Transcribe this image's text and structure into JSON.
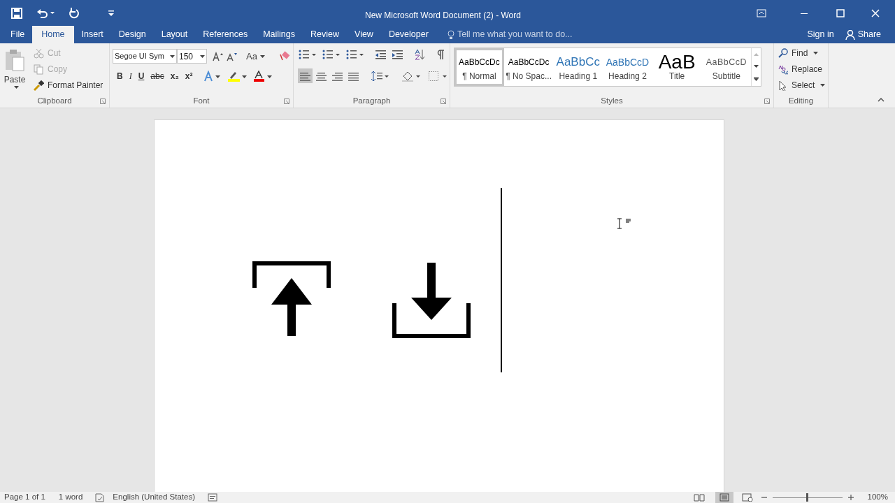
{
  "window": {
    "title": "New Microsoft Word Document (2) - Word"
  },
  "tabs": [
    {
      "label": "File",
      "selected": false
    },
    {
      "label": "Home",
      "selected": true
    },
    {
      "label": "Insert",
      "selected": false
    },
    {
      "label": "Design",
      "selected": false
    },
    {
      "label": "Layout",
      "selected": false
    },
    {
      "label": "References",
      "selected": false
    },
    {
      "label": "Mailings",
      "selected": false
    },
    {
      "label": "Review",
      "selected": false
    },
    {
      "label": "View",
      "selected": false
    },
    {
      "label": "Developer",
      "selected": false
    }
  ],
  "tell_me": {
    "placeholder": "Tell me what you want to do..."
  },
  "account": {
    "sign_in": "Sign in",
    "share": "Share"
  },
  "clipboard": {
    "paste": "Paste",
    "items": [
      {
        "label": "Cut",
        "disabled": true
      },
      {
        "label": "Copy",
        "disabled": true
      },
      {
        "label": "Format Painter",
        "disabled": false
      }
    ],
    "group_label": "Clipboard"
  },
  "font": {
    "font_name": "Segoe UI Sym",
    "font_size": "150",
    "change_case": "Aa",
    "format_buttons": [
      "B",
      "I",
      "U",
      "abc",
      "x₂",
      "x²"
    ],
    "group_label": "Font"
  },
  "paragraph": {
    "alignments": [
      {
        "selected": true
      },
      {
        "selected": false
      },
      {
        "selected": false
      },
      {
        "selected": false
      }
    ],
    "group_label": "Paragraph"
  },
  "styles": {
    "items": [
      {
        "preview": "AaBbCcDc",
        "label": "¶ Normal",
        "kind": "normal",
        "selected": true
      },
      {
        "preview": "AaBbCcDc",
        "label": "¶ No Spac...",
        "kind": "normal",
        "selected": false
      },
      {
        "preview": "AaBbCc",
        "label": "Heading 1",
        "kind": "heading1",
        "selected": false
      },
      {
        "preview": "AaBbCcD",
        "label": "Heading 2",
        "kind": "heading2",
        "selected": false
      },
      {
        "preview": "AaB",
        "label": "Title",
        "kind": "title",
        "selected": false
      },
      {
        "preview": "AaBbCcD",
        "label": "Subtitle",
        "kind": "subtitle",
        "selected": false
      }
    ],
    "group_label": "Styles"
  },
  "editing": {
    "items": [
      "Find",
      "Replace",
      "Select"
    ],
    "group_label": "Editing"
  },
  "status_bar": {
    "page": "Page 1 of 1",
    "words": "1 word",
    "language": "English (United States)",
    "zoom": "100%",
    "zoom_level": {
      "level": 0.5
    }
  }
}
